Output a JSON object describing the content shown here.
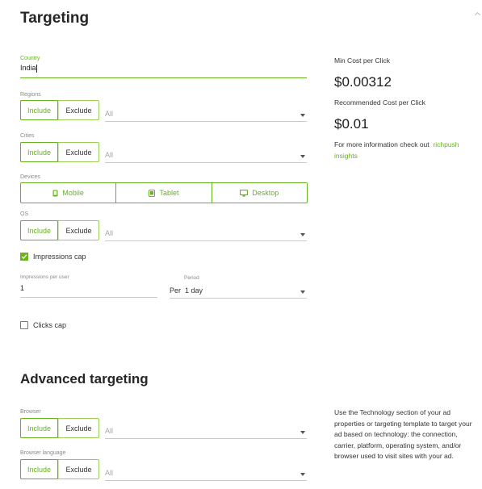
{
  "targeting": {
    "title": "Targeting",
    "country": {
      "label": "Country",
      "value": "India"
    },
    "regions": {
      "label": "Regions",
      "include": "Include",
      "exclude": "Exclude",
      "placeholder": "All"
    },
    "cities": {
      "label": "Cities",
      "include": "Include",
      "exclude": "Exclude",
      "placeholder": "All"
    },
    "devices": {
      "label": "Devices",
      "options": [
        "Mobile",
        "Tablet",
        "Desktop"
      ]
    },
    "os": {
      "label": "OS",
      "include": "Include",
      "exclude": "Exclude",
      "placeholder": "All"
    },
    "impressions_cap": {
      "label": "Impressions cap",
      "checked": true
    },
    "impressions_per_user": {
      "label": "Impressions per user",
      "value": "1"
    },
    "period": {
      "label": "Period",
      "value": "Per  1 day"
    },
    "clicks_cap": {
      "label": "Clicks cap",
      "checked": false
    }
  },
  "cost_panel": {
    "min_cost_label": "Min Cost per Click",
    "min_cost_value": "$0.00312",
    "recommended_label": "Recommended Cost per Click",
    "recommended_value": "$0.01",
    "info_text": "For more information check out",
    "info_link": "richpush insights"
  },
  "advanced": {
    "title": "Advanced targeting",
    "browser": {
      "label": "Browser",
      "include": "Include",
      "exclude": "Exclude",
      "placeholder": "All"
    },
    "browser_language": {
      "label": "Browser language",
      "include": "Include",
      "exclude": "Exclude",
      "placeholder": "All"
    },
    "info_text": "Use the Technology section of your ad properties or targeting template to target your ad based on technology: the connection, carrier, platform, operating system, and/or browser used to visit sites with your ad."
  },
  "colors": {
    "accent": "#67b21f"
  }
}
